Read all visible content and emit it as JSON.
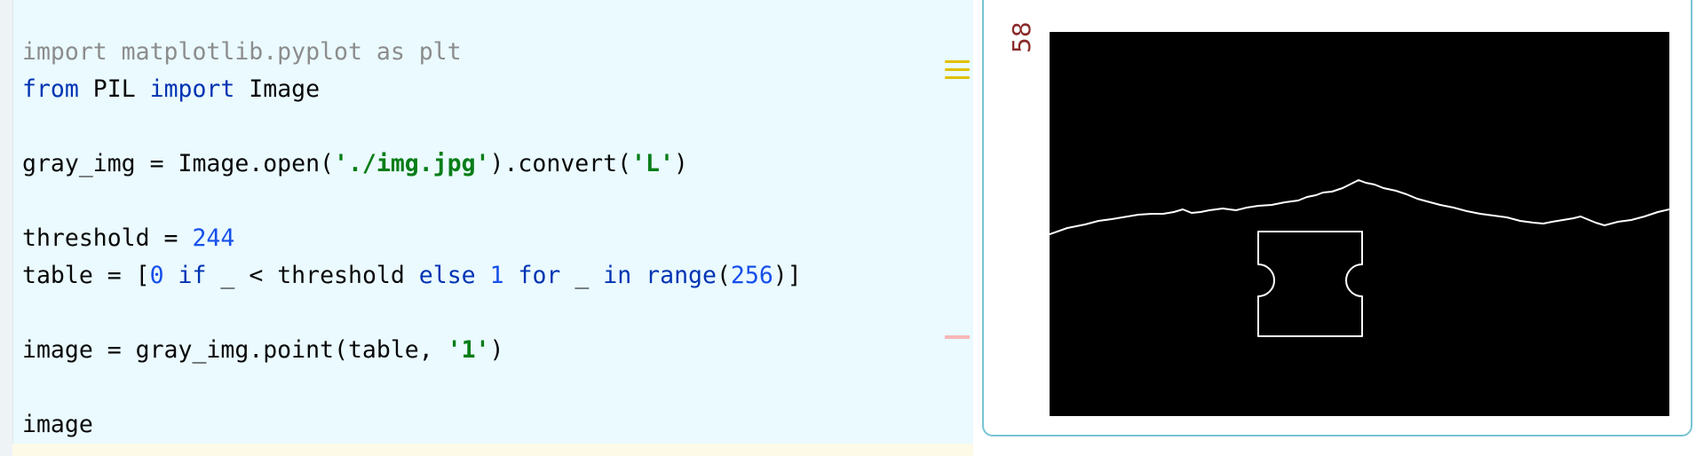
{
  "editor": {
    "lines": [
      {
        "tokens": [
          {
            "t": "import matplotlib.pyplot as plt",
            "c": "cmt"
          }
        ]
      },
      {
        "tokens": [
          {
            "t": "from",
            "c": "kw"
          },
          {
            "t": " PIL ",
            "c": ""
          },
          {
            "t": "import",
            "c": "kw"
          },
          {
            "t": " Image",
            "c": ""
          }
        ]
      },
      {
        "tokens": []
      },
      {
        "tokens": [
          {
            "t": "gray_img = Image.open(",
            "c": ""
          },
          {
            "t": "'./img.jpg'",
            "c": "str"
          },
          {
            "t": ").convert(",
            "c": ""
          },
          {
            "t": "'L'",
            "c": "str"
          },
          {
            "t": ")",
            "c": ""
          }
        ]
      },
      {
        "tokens": []
      },
      {
        "tokens": [
          {
            "t": "threshold = ",
            "c": ""
          },
          {
            "t": "244",
            "c": "num"
          }
        ]
      },
      {
        "tokens": [
          {
            "t": "table = [",
            "c": ""
          },
          {
            "t": "0",
            "c": "num"
          },
          {
            "t": " ",
            "c": ""
          },
          {
            "t": "if",
            "c": "kw"
          },
          {
            "t": " _ < threshold ",
            "c": ""
          },
          {
            "t": "else",
            "c": "kw"
          },
          {
            "t": " ",
            "c": ""
          },
          {
            "t": "1",
            "c": "num"
          },
          {
            "t": " ",
            "c": ""
          },
          {
            "t": "for",
            "c": "kw"
          },
          {
            "t": " _ ",
            "c": ""
          },
          {
            "t": "in",
            "c": "kw"
          },
          {
            "t": " ",
            "c": ""
          },
          {
            "t": "range",
            "c": "kw"
          },
          {
            "t": "(",
            "c": ""
          },
          {
            "t": "256",
            "c": "num"
          },
          {
            "t": ")]",
            "c": ""
          }
        ]
      },
      {
        "tokens": []
      },
      {
        "tokens": [
          {
            "t": "image = gray_img.point(table, ",
            "c": ""
          },
          {
            "t": "'1'",
            "c": "str"
          },
          {
            "t": ")",
            "c": ""
          }
        ]
      },
      {
        "tokens": []
      },
      {
        "tokens": [
          {
            "t": "image",
            "c": ""
          }
        ]
      }
    ]
  },
  "output": {
    "execution_count": "58",
    "image_description": "binary thresholded image: white outline of mountain ridge and a puzzle-shaped rectangle on black background"
  },
  "colors": {
    "editor_bg": "#eafaff",
    "keyword": "#0033b3",
    "string": "#067d17",
    "number": "#1750eb",
    "comment": "#8c8c8c",
    "output_border": "#77c4d3",
    "execution_count": "#8a2b2b"
  },
  "icons": {
    "warning_marker": "hamburger-marker-icon"
  }
}
